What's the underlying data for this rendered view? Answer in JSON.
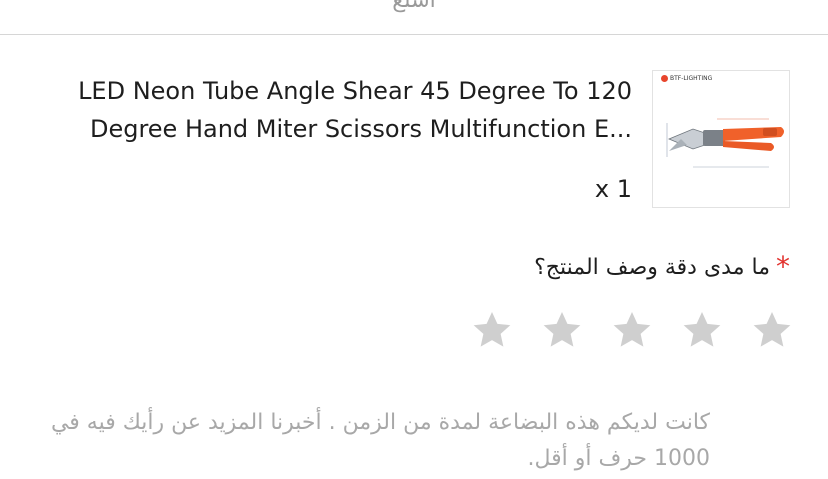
{
  "header": {
    "partial_label": "أسلع"
  },
  "product": {
    "title_line1": "LED Neon Tube Angle Shear 45 Degree To 120",
    "title_line2": "Degree Hand Miter Scissors Multifunction E...",
    "quantity": "x 1",
    "thumbnail_brand": "BTF-LIGHTING"
  },
  "rating": {
    "required_mark": "*",
    "question": "ما مدى دقة وصف المنتج؟",
    "max_stars": 5,
    "selected": 0,
    "star_color": "#cfcfcf"
  },
  "review": {
    "placeholder": "كانت لديكم هذه البضاعة لمدة من الزمن . أخبرنا المزيد عن رأيك فيه في 1000 حرف أو أقل."
  },
  "colors": {
    "accent": "#e2332f",
    "divider": "#d6d6d6",
    "placeholder_text": "#a8a8a8"
  }
}
